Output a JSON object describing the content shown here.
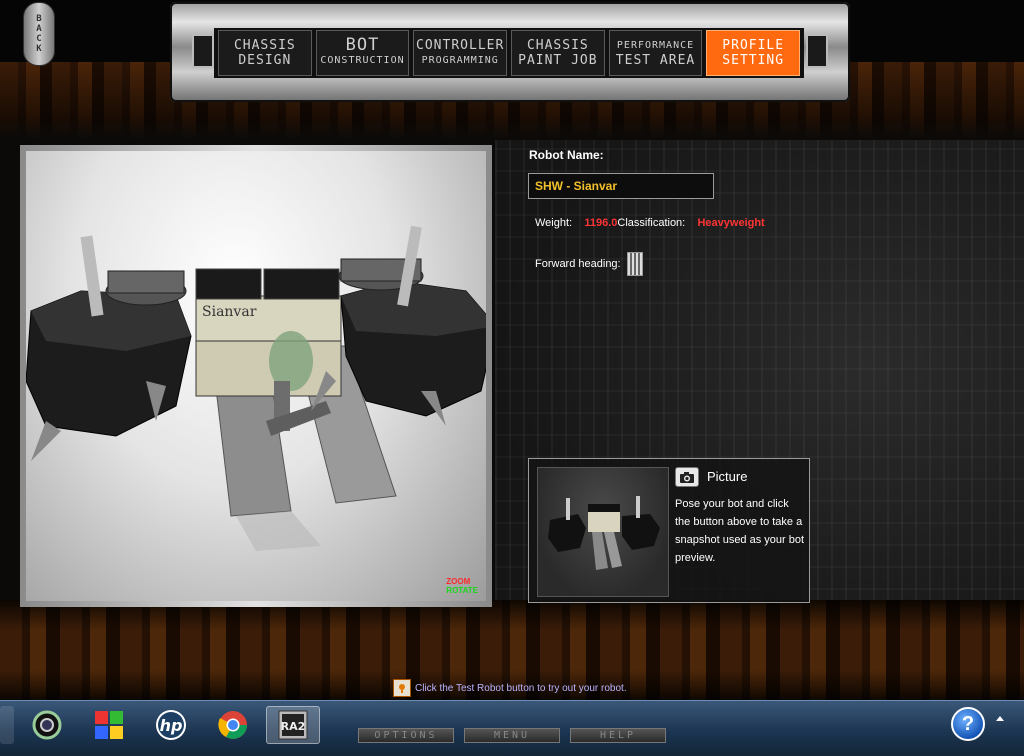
{
  "back_button": {
    "label": "BACK"
  },
  "nav": {
    "tabs": [
      {
        "line1": "CHASSIS",
        "line2": "DESIGN",
        "active": false
      },
      {
        "line1": "BOT",
        "line2": "CONSTRUCTION",
        "active": false
      },
      {
        "line1": "CONTROLLER",
        "line2": "PROGRAMMING",
        "active": false
      },
      {
        "line1": "CHASSIS",
        "line2": "PAINT JOB",
        "active": false
      },
      {
        "line1": "PERFORMANCE",
        "line2": "TEST AREA",
        "active": false
      },
      {
        "line1": "PROFILE",
        "line2": "SETTING",
        "active": true
      }
    ]
  },
  "viewport": {
    "zoom_label": "ZOOM",
    "rotate_label": "ROTATE",
    "bot_texture_text": "Sianvar"
  },
  "profile": {
    "robot_name_label": "Robot Name:",
    "robot_name_value": "SHW - Sianvar",
    "weight_label": "Weight:",
    "weight_value": "1196.0",
    "classification_label": "Classification:",
    "classification_value": "Heavyweight",
    "forward_heading_label": "Forward heading:"
  },
  "picture": {
    "title": "Picture",
    "description": "Pose your bot and click the button above to take a snapshot used as your bot preview."
  },
  "hint": {
    "text": "Click the Test Robot button to try out your robot."
  },
  "game_menu": {
    "options": "OPTIONS",
    "menu": "MENU",
    "help": "HELP"
  },
  "taskbar": {
    "ra2_label": "RA2",
    "hp_label": "hp"
  },
  "colors": {
    "accent": "#ff6a10",
    "value_red": "#ff3434",
    "name_gold": "#f2c02a"
  }
}
